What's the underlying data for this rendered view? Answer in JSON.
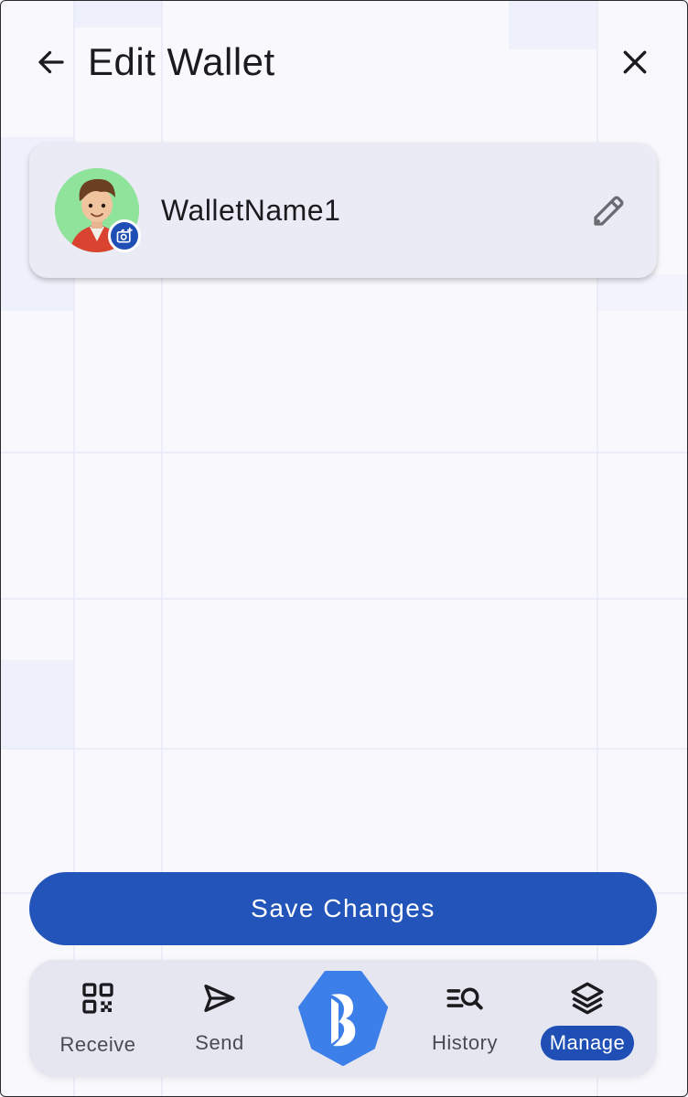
{
  "header": {
    "title": "Edit Wallet"
  },
  "wallet": {
    "name": "WalletName1"
  },
  "save_button": {
    "label": "Save Changes"
  },
  "nav": {
    "receive": "Receive",
    "send": "Send",
    "history": "History",
    "manage": "Manage",
    "active": "manage"
  },
  "icons": {
    "back": "arrow-left-icon",
    "close": "close-icon",
    "edit": "pencil-icon",
    "camera": "camera-icon",
    "receive": "qr-code-icon",
    "send": "send-icon",
    "history": "history-search-icon",
    "manage": "layers-icon",
    "logo": "brand-logo-icon"
  },
  "colors": {
    "primary": "#2254b9",
    "background": "#f8f8fd",
    "card": "#ebebf5",
    "nav": "#e6e6f1",
    "avatar_bg": "#8fe39a",
    "logo": "#3d7fe9"
  }
}
